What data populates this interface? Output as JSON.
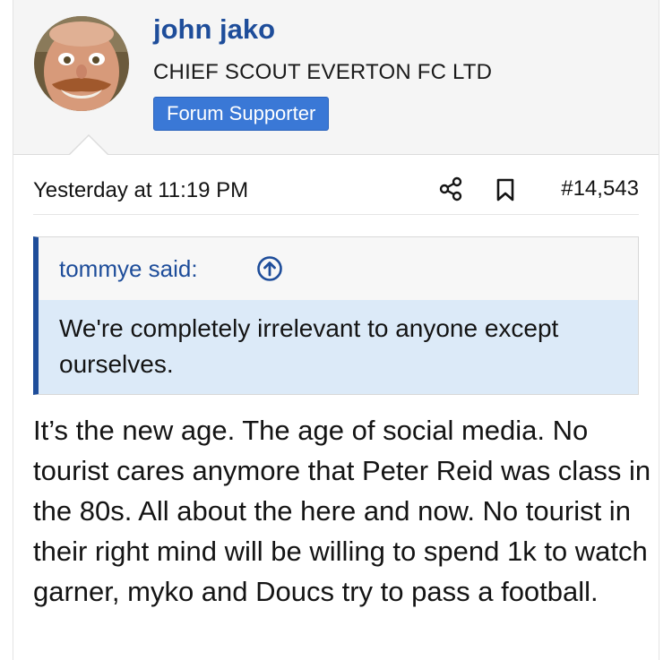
{
  "colors": {
    "username": "#1e4d9a",
    "banner_bg": "#3a78d6",
    "quote_border": "#1e4d9a",
    "quote_body_bg": "#dceaf8",
    "header_bg": "#f5f5f5"
  },
  "user": {
    "name": "john jako",
    "title": "CHIEF SCOUT EVERTON FC LTD",
    "banner": "Forum Supporter",
    "avatar_icon": "avatar-photo"
  },
  "post": {
    "date": "Yesterday at 11:19 PM",
    "number": "#14,543",
    "share_icon": "share-icon",
    "bookmark_icon": "bookmark-icon",
    "quote": {
      "author": "tommye said:",
      "jump_icon": "arrow-up-circle-icon",
      "text": "We're completely irrelevant to anyone except ourselves."
    },
    "body": "It’s the new age. The age of social media. No tourist cares anymore that Peter Reid was class in the 80s. All about the here and now. No tourist in their right mind will be willing to spend 1k to watch garner, myko and Doucs try to pass a football."
  }
}
